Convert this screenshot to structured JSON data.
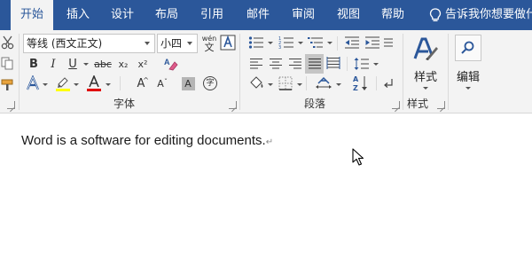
{
  "tabs": [
    {
      "label": "开始",
      "active": true
    },
    {
      "label": "插入",
      "active": false
    },
    {
      "label": "设计",
      "active": false
    },
    {
      "label": "布局",
      "active": false
    },
    {
      "label": "引用",
      "active": false
    },
    {
      "label": "邮件",
      "active": false
    },
    {
      "label": "审阅",
      "active": false
    },
    {
      "label": "视图",
      "active": false
    },
    {
      "label": "帮助",
      "active": false
    }
  ],
  "tell_me": "告诉我你想要做什么",
  "font_group": {
    "font_name": "等线 (西文正文)",
    "font_size": "小四",
    "phonetic": "wén",
    "phonetic_char": "文",
    "bold": "B",
    "italic": "I",
    "underline": "U",
    "strike": "abc",
    "subscript": "x₂",
    "superscript": "x²",
    "grow": "A",
    "shrink": "A",
    "shade": "A",
    "enclose": "字",
    "label": "字体"
  },
  "paragraph_group": {
    "label": "段落"
  },
  "styles_group": {
    "button": "样式",
    "label": "样式"
  },
  "editing_group": {
    "button": "编辑"
  },
  "colors": {
    "tab_bar": "#2b579a",
    "highlight": "#ffff00",
    "font_color": "#e00000",
    "accent": "#2b579a"
  },
  "document": {
    "text": "Word is a software for editing documents.",
    "para_mark": "↵"
  }
}
